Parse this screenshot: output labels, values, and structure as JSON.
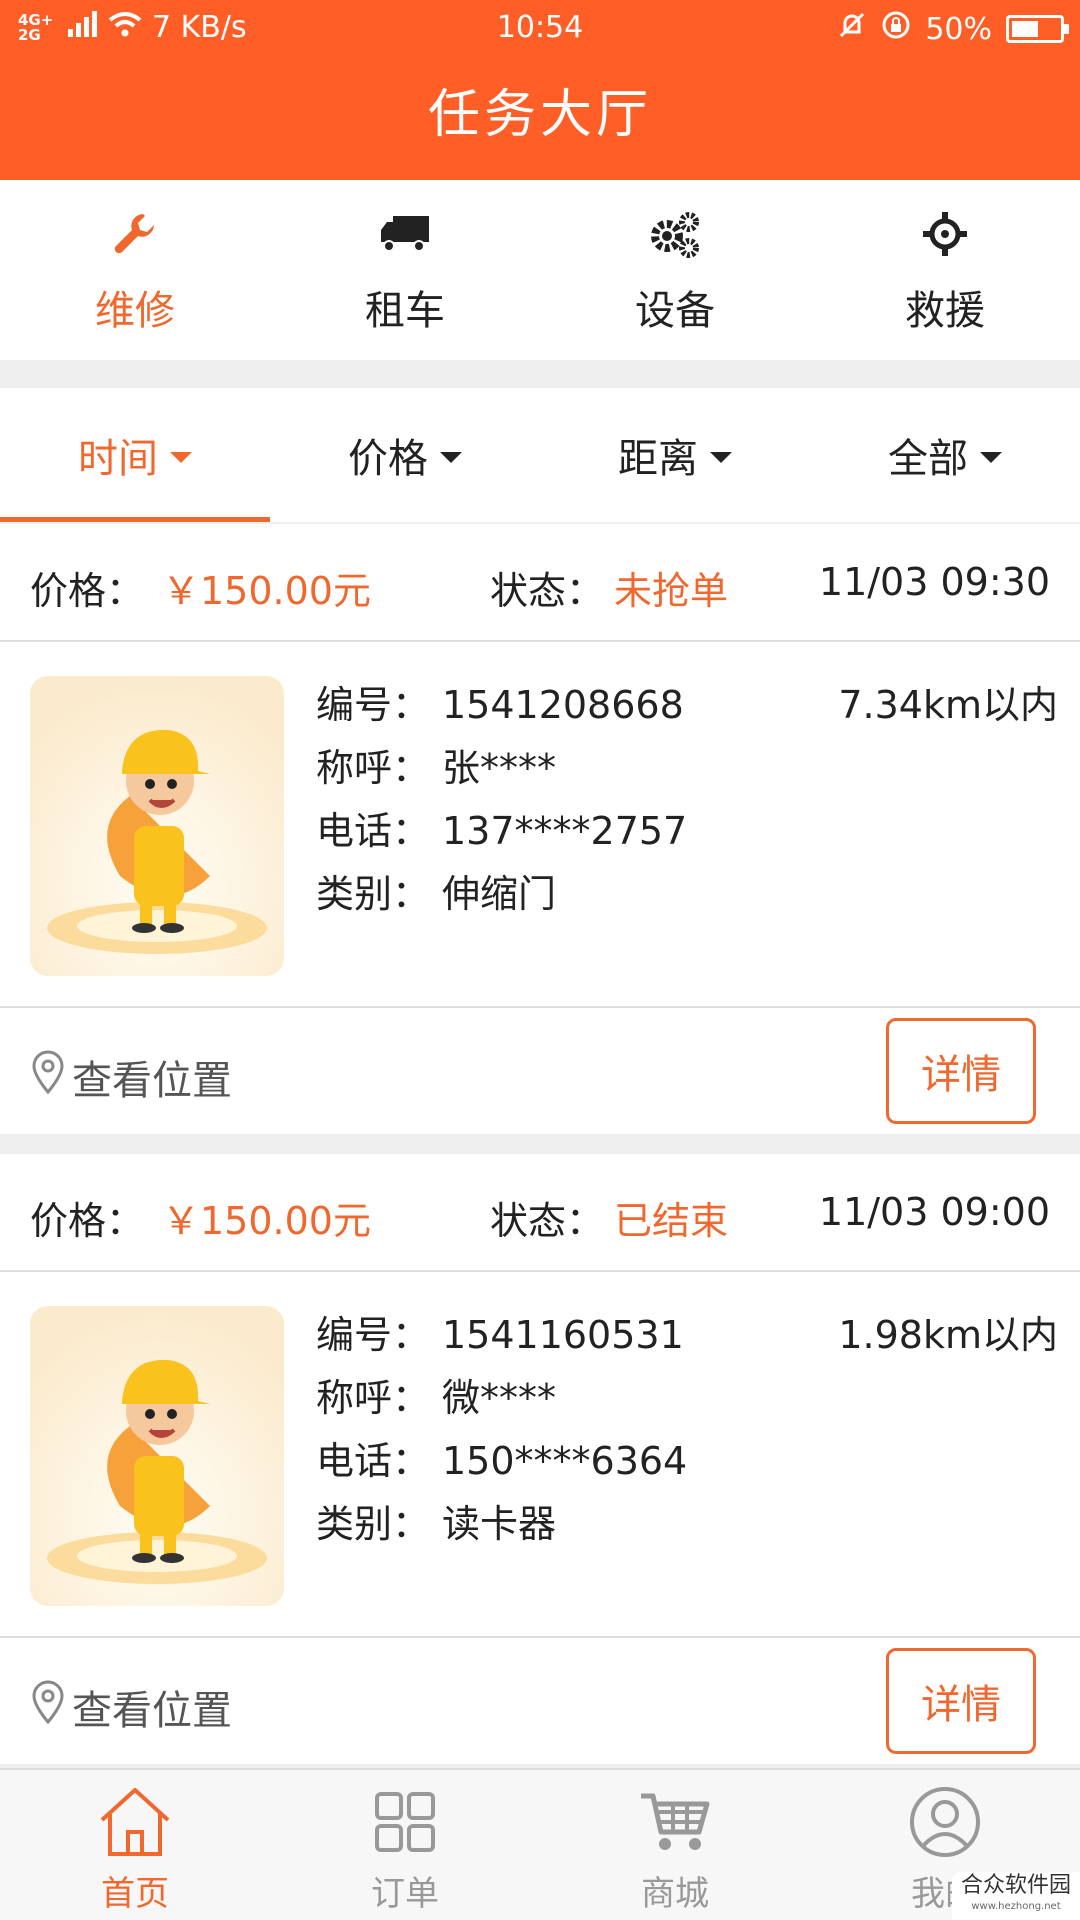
{
  "status_bar": {
    "network": "4G+ 2G",
    "speed": "7 KB/s",
    "time": "10:54",
    "battery": "50%",
    "battery_level": 0.5
  },
  "header": {
    "title": "任务大厅"
  },
  "categories": [
    {
      "label": "维修",
      "icon": "wrench-icon",
      "active": true
    },
    {
      "label": "租车",
      "icon": "truck-icon",
      "active": false
    },
    {
      "label": "设备",
      "icon": "gears-icon",
      "active": false
    },
    {
      "label": "救援",
      "icon": "crosshair-icon",
      "active": false
    }
  ],
  "filters": [
    {
      "label": "时间",
      "active": true
    },
    {
      "label": "价格",
      "active": false
    },
    {
      "label": "距离",
      "active": false
    },
    {
      "label": "全部",
      "active": false
    }
  ],
  "labels": {
    "price": "价格：",
    "status": "状态：",
    "number": "编号：",
    "name": "称呼：",
    "phone": "电话：",
    "category": "类别：",
    "view_location": "查看位置",
    "detail": "详情"
  },
  "tasks": [
    {
      "price": "￥150.00元",
      "status": "未抢单",
      "time": "11/03 09:30",
      "number": "1541208668",
      "distance": "7.34km以内",
      "name": "张****",
      "phone": "137****2757",
      "category": "伸缩门"
    },
    {
      "price": "￥150.00元",
      "status": "已结束",
      "time": "11/03 09:00",
      "number": "1541160531",
      "distance": "1.98km以内",
      "name": "微****",
      "phone": "150****6364",
      "category": "读卡器"
    }
  ],
  "bottom_nav": [
    {
      "label": "首页",
      "icon": "home-icon",
      "active": true
    },
    {
      "label": "订单",
      "icon": "grid-icon",
      "active": false
    },
    {
      "label": "商城",
      "icon": "cart-icon",
      "active": false
    },
    {
      "label": "我的",
      "icon": "user-icon",
      "active": false
    }
  ],
  "watermark": {
    "main": "合众软件园",
    "sub": "www.hezhong.net"
  },
  "colors": {
    "header": "#ff5f26",
    "accent": "#f0682e"
  }
}
